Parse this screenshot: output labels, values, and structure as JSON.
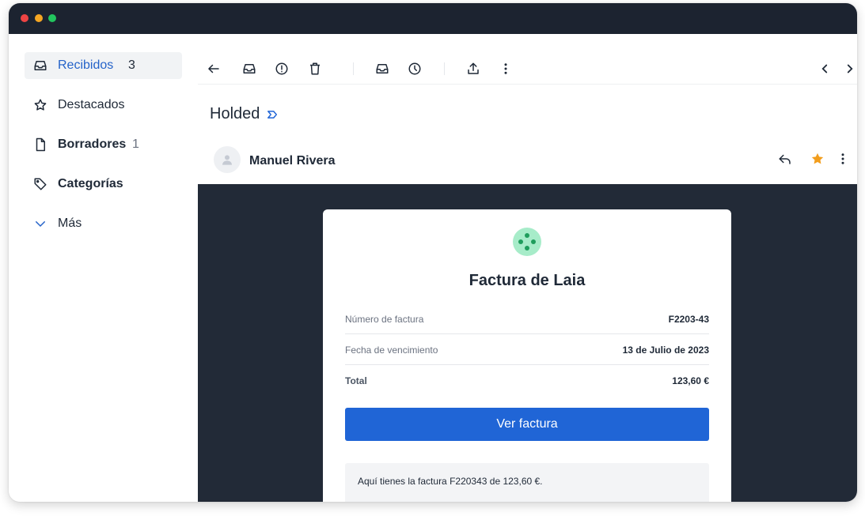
{
  "sidebar": {
    "items": [
      {
        "label": "Recibidos",
        "count": "3",
        "icon": "inbox-icon"
      },
      {
        "label": "Destacados",
        "count": "",
        "icon": "star-outline-icon"
      },
      {
        "label": "Borradores",
        "count": "1",
        "icon": "document-icon"
      },
      {
        "label": "Categorías",
        "count": "",
        "icon": "tag-icon"
      },
      {
        "label": "Más",
        "count": "",
        "icon": "chevron-down-icon"
      }
    ]
  },
  "toolbar": {
    "icons": [
      "back-arrow-icon",
      "archive-icon",
      "report-spam-icon",
      "delete-icon",
      "move-to-inbox-icon",
      "snooze-icon",
      "share-icon",
      "more-vertical-icon",
      "previous-icon",
      "next-icon"
    ]
  },
  "email": {
    "subject": "Holded",
    "sender": "Manuel Rivera",
    "starred": true,
    "accent_color": "#2065d6",
    "star_color": "#f29d1c"
  },
  "invoice": {
    "title": "Factura de Laia",
    "rows": [
      {
        "label": "Número de factura",
        "value": "F2203-43"
      },
      {
        "label": "Fecha de vencimiento",
        "value": "13 de Julio de 2023"
      },
      {
        "label": "Total",
        "value": "123,60 €"
      }
    ],
    "button_label": "Ver factura",
    "note": "Aquí tienes la factura F220343 de 123,60 €."
  }
}
